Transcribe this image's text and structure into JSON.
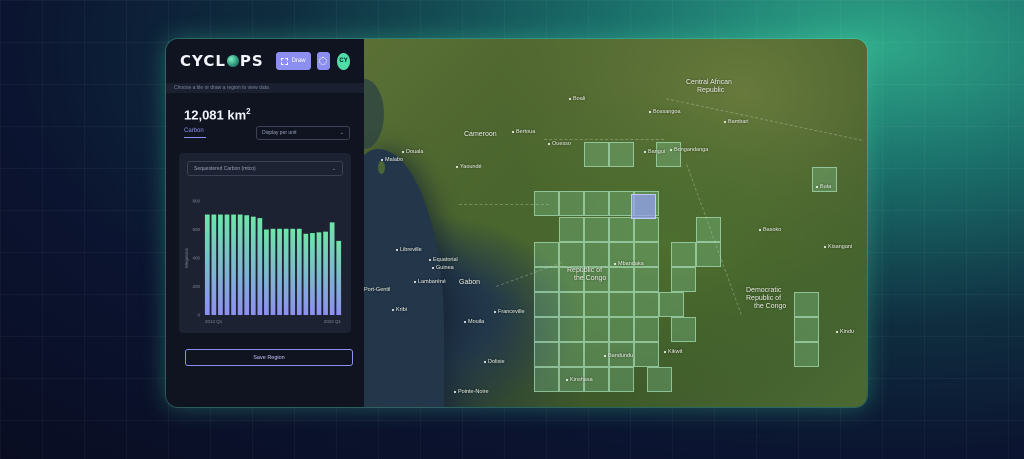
{
  "app": {
    "logo": {
      "part1": "CYCL",
      "part2": "PS"
    },
    "draw_label": "Draw",
    "avatar_initials": "CY",
    "hint": "Choose a tile or draw a region to view data",
    "area": {
      "value": "12,081 km",
      "exp": "2"
    },
    "tab_carbon": "Carbon",
    "display_select": "Display per unit",
    "metric_select": "Sequestered Carbon (mtco)",
    "save_label": "Save Region",
    "colors": {
      "accent": "#8d8ff0",
      "brand_green": "#4fdca6",
      "panel": "#0f1420"
    }
  },
  "chart_data": {
    "type": "bar",
    "ylabel": "Megatons",
    "ylim": [
      0,
      800
    ],
    "yticks": [
      "800",
      "600",
      "400",
      "200",
      "0"
    ],
    "x_start_label": "2012 Q1",
    "x_end_label": "2022 Q1",
    "values": [
      705,
      705,
      705,
      705,
      705,
      705,
      700,
      690,
      680,
      600,
      605,
      605,
      605,
      605,
      605,
      570,
      575,
      580,
      585,
      650,
      520
    ],
    "gradient": [
      "#6ee6a8",
      "#8d8ff0"
    ]
  },
  "map": {
    "labels": [
      {
        "text": "Central African",
        "big": true
      },
      {
        "text": "Republic",
        "big": true
      },
      {
        "text": "Cameroon",
        "big": true
      },
      {
        "text": "Equatorial",
        "big": false
      },
      {
        "text": "Guinea",
        "big": false
      },
      {
        "text": "Gabon",
        "big": true
      },
      {
        "text": "Republic of",
        "big": true
      },
      {
        "text": "the Congo",
        "big": true
      },
      {
        "text": "Democratic",
        "big": true
      },
      {
        "text": "Republic of",
        "big": true
      },
      {
        "text": "the Congo",
        "big": true
      },
      {
        "text": "Malabo",
        "big": false
      },
      {
        "text": "Douala",
        "big": false
      },
      {
        "text": "Yaoundé",
        "big": false
      },
      {
        "text": "Libreville",
        "big": false
      },
      {
        "text": "Port-Gentil",
        "big": false
      },
      {
        "text": "Lambaréné",
        "big": false
      },
      {
        "text": "Franceville",
        "big": false
      },
      {
        "text": "Ouesso",
        "big": false
      },
      {
        "text": "Mbandaka",
        "big": false
      },
      {
        "text": "Kinshasa",
        "big": false
      },
      {
        "text": "Pointe-Noire",
        "big": false
      },
      {
        "text": "Bangui",
        "big": false
      },
      {
        "text": "Boali",
        "big": false
      },
      {
        "text": "Bossangoa",
        "big": false
      },
      {
        "text": "Bambari",
        "big": false
      },
      {
        "text": "Bongandanga",
        "big": false
      },
      {
        "text": "Kisangani",
        "big": false
      },
      {
        "text": "Basoko",
        "big": false
      },
      {
        "text": "Buta",
        "big": false
      },
      {
        "text": "Kindu",
        "big": false
      },
      {
        "text": "Bandundu",
        "big": false
      },
      {
        "text": "Kikwit",
        "big": false
      },
      {
        "text": "Bertoua",
        "big": false
      },
      {
        "text": "Kribi",
        "big": false
      },
      {
        "text": "Mouila",
        "big": false
      },
      {
        "text": "Dolisie",
        "big": false
      }
    ]
  }
}
